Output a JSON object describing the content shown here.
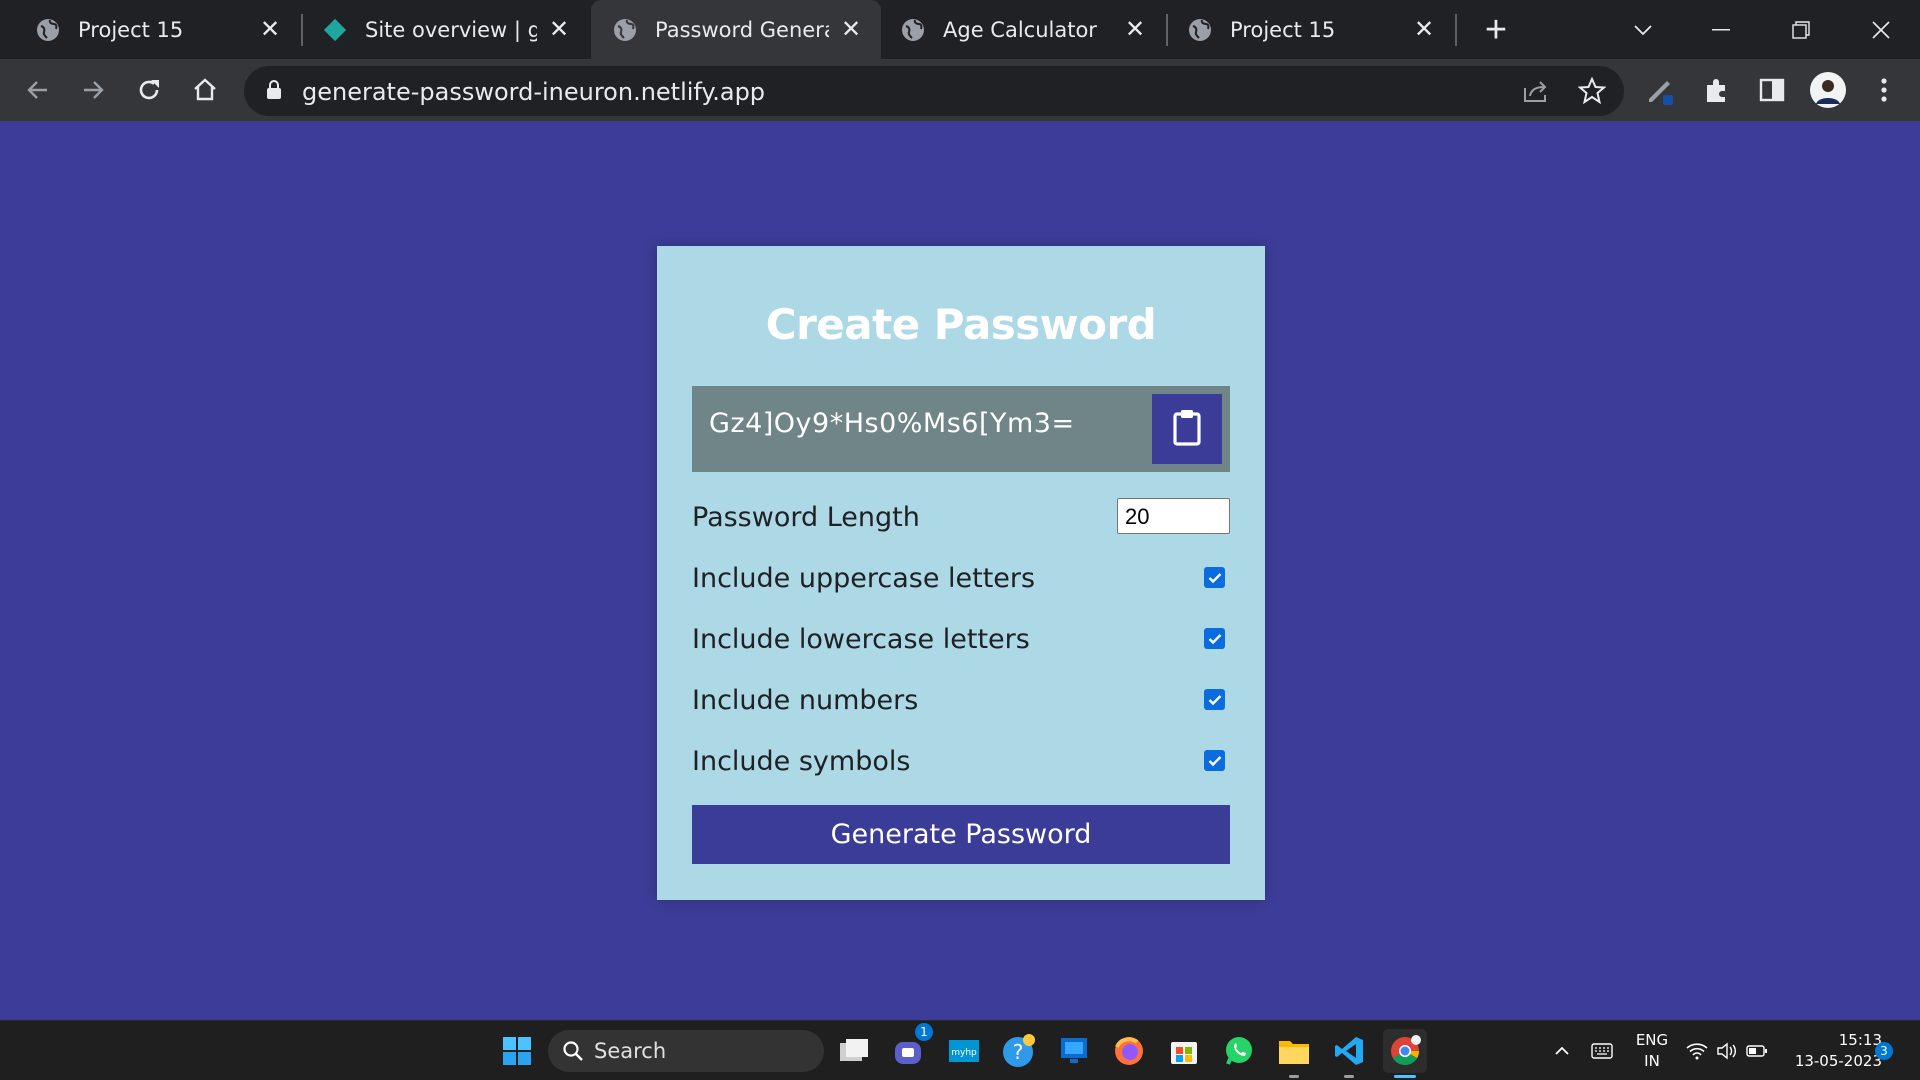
{
  "browser": {
    "tabs": [
      {
        "title": "Project 15",
        "favicon": "globe-icon"
      },
      {
        "title": "Site overview | gen",
        "favicon": "netlify-icon"
      },
      {
        "title": "Password Generato",
        "favicon": "globe-icon",
        "active": true
      },
      {
        "title": "Age Calculator",
        "favicon": "globe-icon"
      },
      {
        "title": "Project 15",
        "favicon": "globe-icon"
      }
    ],
    "url": "generate-password-ineuron.netlify.app"
  },
  "app": {
    "title": "Create Password",
    "generated_password": "Gz4]Oy9*Hs0%Ms6[Ym3=",
    "length_label": "Password Length",
    "length_value": "20",
    "options": [
      {
        "label": "Include uppercase letters",
        "checked": true
      },
      {
        "label": "Include lowercase letters",
        "checked": true
      },
      {
        "label": "Include numbers",
        "checked": true
      },
      {
        "label": "Include symbols",
        "checked": true
      }
    ],
    "generate_label": "Generate Password",
    "colors": {
      "background": "#3d3d99",
      "card": "#add8e6",
      "result": "#708587",
      "accent": "#3b3b98"
    }
  },
  "taskbar": {
    "search_label": "Search",
    "teams_badge": "1",
    "lang_line1": "ENG",
    "lang_line2": "IN",
    "time": "15:13",
    "date": "13-05-2023",
    "notification_count": "3"
  }
}
